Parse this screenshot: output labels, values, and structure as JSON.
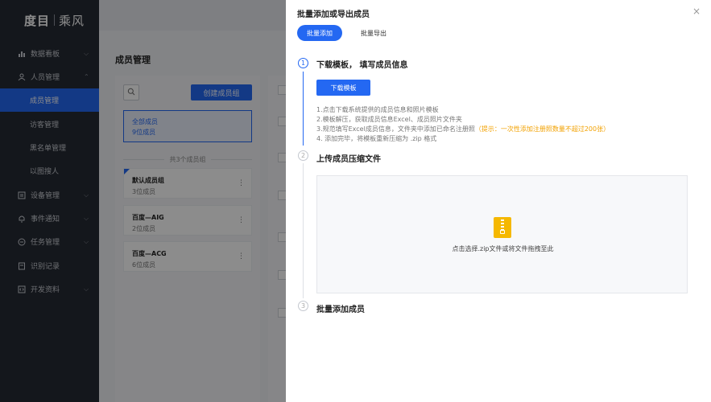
{
  "sidebar": {
    "logo": {
      "part1": "度目",
      "part2": "乘风"
    },
    "items": [
      {
        "label": "数据看板",
        "icon": "bar-chart-icon",
        "expandable": true
      },
      {
        "label": "人员管理",
        "icon": "user-icon",
        "expandable": true
      },
      {
        "label": "成员管理",
        "sub": true,
        "active": true
      },
      {
        "label": "访客管理",
        "sub": true
      },
      {
        "label": "黑名单管理",
        "sub": true
      },
      {
        "label": "以图搜人",
        "sub": true
      },
      {
        "label": "设备管理",
        "icon": "device-icon",
        "expandable": true
      },
      {
        "label": "事件通知",
        "icon": "bell-icon",
        "expandable": true
      },
      {
        "label": "任务管理",
        "icon": "task-icon",
        "expandable": true
      },
      {
        "label": "识别记录",
        "icon": "record-icon",
        "expandable": false
      },
      {
        "label": "开发资料",
        "icon": "code-icon",
        "expandable": true
      }
    ]
  },
  "main": {
    "page_title": "成员管理",
    "create_button": "创建成员组",
    "all_members": {
      "label": "全部成员",
      "count": "9位成员"
    },
    "group_count_text": "共3个成员组",
    "groups": [
      {
        "name": "默认成员组",
        "count": "3位成员"
      },
      {
        "name": "百度—AIG",
        "count": "2位成员"
      },
      {
        "name": "百度—ACG",
        "count": "6位成员"
      }
    ]
  },
  "drawer": {
    "title": "批量添加或导出成员",
    "tabs": [
      {
        "label": "批量添加",
        "active": true
      },
      {
        "label": "批量导出",
        "active": false
      }
    ],
    "steps": [
      {
        "num": "1",
        "title": "下载模板， 填写成员信息"
      },
      {
        "num": "2",
        "title": "上传成员压缩文件"
      },
      {
        "num": "3",
        "title": "批量添加成员"
      }
    ],
    "download_button": "下载模板",
    "instructions": [
      "1.点击下载系统提供的成员信息和照片模板",
      "2.模板解压，获取成员信息Excel、成员照片文件夹",
      "3.规范填写Excel成员信息，文件夹中添加已命名注册照",
      "4. 添加完毕，将模板重新压缩为 .zip 格式"
    ],
    "instruction_highlight": "（提示：一次性添加注册照数量不超过200张）",
    "upload_text": "点击选择.zip文件或将文件拖拽至此"
  },
  "colors": {
    "accent": "#2468f2",
    "sidebar_bg": "#262a33",
    "warning": "#f2a100",
    "zip_icon": "#f5b800"
  }
}
